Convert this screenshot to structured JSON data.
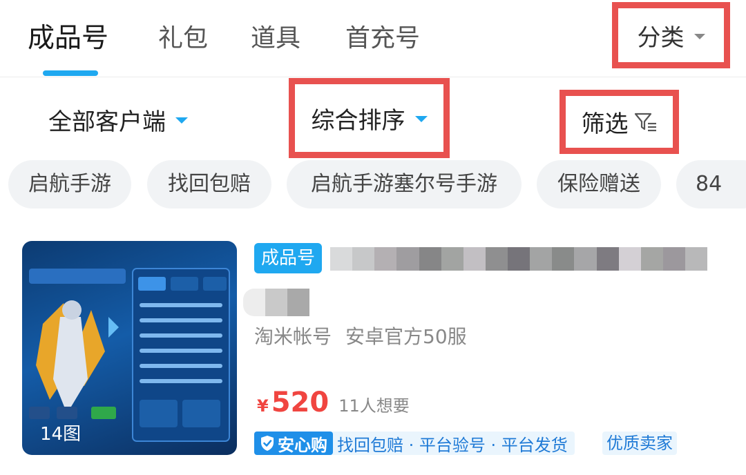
{
  "tabs": [
    {
      "label": "成品号",
      "active": true
    },
    {
      "label": "礼包"
    },
    {
      "label": "道具"
    },
    {
      "label": "首充号"
    }
  ],
  "category": {
    "label": "分类"
  },
  "filters": {
    "client": "全部客户端",
    "sort": "综合排序",
    "screen": "筛选"
  },
  "chips": [
    "启航手游",
    "找回包赔",
    "启航手游塞尔号手游",
    "保险赠送",
    "84"
  ],
  "listing": {
    "image_count": "14图",
    "type_badge": "成品号",
    "platform": "淘米帐号",
    "server": "安卓官方50服",
    "currency": "¥",
    "price": "520",
    "wants": "11人想要",
    "guarantee_label": "安心购",
    "guarantee_text": "找回包赔 · 平台验号 · 平台发货",
    "seller_badge": "优质卖家"
  },
  "colors": {
    "accent": "#1fa8f0",
    "highlight_box": "#e8514f",
    "price": "#f04540"
  }
}
